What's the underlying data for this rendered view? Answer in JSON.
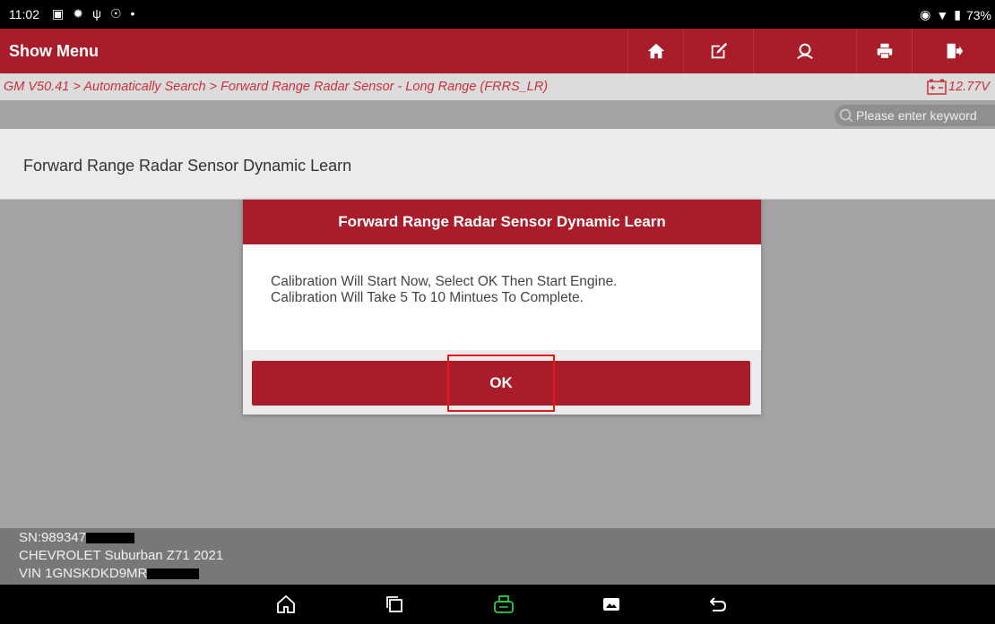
{
  "status_bar": {
    "time": "11:02",
    "battery": "73%"
  },
  "header": {
    "title": "Show Menu",
    "tools": [
      "home-icon",
      "edit-icon",
      "help-icon",
      "print-icon",
      "exit-icon"
    ]
  },
  "breadcrumb": {
    "path": "GM V50.41 > Automatically Search > Forward Range Radar Sensor - Long Range (FRRS_LR)",
    "voltage": "12.77V"
  },
  "search": {
    "placeholder": "Please enter keyword"
  },
  "list": {
    "item": "Forward Range Radar Sensor Dynamic Learn"
  },
  "dialog": {
    "title": "Forward Range Radar Sensor Dynamic Learn",
    "line1": "Calibration Will Start Now, Select OK Then Start Engine.",
    "line2": "Calibration Will Take 5 To 10 Mintues To Complete.",
    "ok_label": "OK"
  },
  "vehicle": {
    "sn": "SN:989347",
    "model": "CHEVROLET Suburban Z71 2021",
    "vin": "VIN 1GNSKDKD9MR"
  },
  "colors": {
    "brand_red": "#a81d29",
    "accent_red": "#c8323c"
  }
}
